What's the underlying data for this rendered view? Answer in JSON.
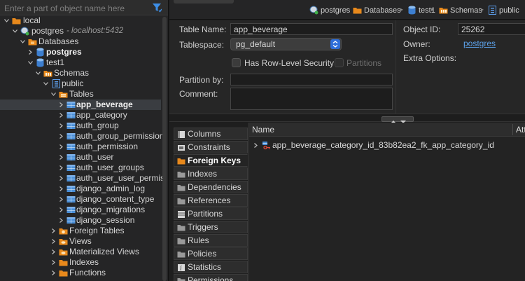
{
  "navigator": {
    "filter_placeholder": "Enter a part of object name here",
    "tree": [
      {
        "label": "local",
        "bold": false
      },
      {
        "label": "postgres",
        "host": "- localhost:5432",
        "bold": false
      },
      {
        "label": "Databases",
        "bold": false
      },
      {
        "label": "postgres",
        "bold": true
      },
      {
        "label": "test1",
        "bold": false
      },
      {
        "label": "Schemas",
        "bold": false
      },
      {
        "label": "public",
        "bold": false
      },
      {
        "label": "Tables",
        "bold": false
      },
      {
        "label": "app_beverage",
        "bold": true,
        "selected": true
      },
      {
        "label": "app_category",
        "bold": false
      },
      {
        "label": "auth_group",
        "bold": false
      },
      {
        "label": "auth_group_permission",
        "bold": false
      },
      {
        "label": "auth_permission",
        "bold": false
      },
      {
        "label": "auth_user",
        "bold": false
      },
      {
        "label": "auth_user_groups",
        "bold": false
      },
      {
        "label": "auth_user_user_permis",
        "bold": false
      },
      {
        "label": "django_admin_log",
        "bold": false
      },
      {
        "label": "django_content_type",
        "bold": false
      },
      {
        "label": "django_migrations",
        "bold": false
      },
      {
        "label": "django_session",
        "bold": false
      },
      {
        "label": "Foreign Tables",
        "bold": false
      },
      {
        "label": "Views",
        "bold": false
      },
      {
        "label": "Materialized Views",
        "bold": false
      },
      {
        "label": "Indexes",
        "bold": false
      },
      {
        "label": "Functions",
        "bold": false
      }
    ]
  },
  "breadcrumb": [
    "postgres",
    "Databases",
    "test1",
    "Schemas",
    "public"
  ],
  "properties": {
    "table_name_label": "Table Name:",
    "table_name_value": "app_beverage",
    "tablespace_label": "Tablespace:",
    "tablespace_value": "pg_default",
    "rls_label": "Has Row-Level Security",
    "partitions_label": "Partitions",
    "partition_by_label": "Partition by:",
    "partition_by_value": "",
    "comment_label": "Comment:",
    "comment_value": "",
    "object_id_label": "Object ID:",
    "object_id_value": "25262",
    "owner_label": "Owner:",
    "owner_value": "postgres",
    "extra_options_label": "Extra Options:"
  },
  "tabs": [
    "Columns",
    "Constraints",
    "Foreign Keys",
    "Indexes",
    "Dependencies",
    "References",
    "Partitions",
    "Triggers",
    "Rules",
    "Policies",
    "Statistics",
    "Permissions"
  ],
  "active_tab": "Foreign Keys",
  "grid": {
    "columns": [
      "Name",
      "Attr"
    ],
    "rows": [
      "app_beverage_category_id_83b82ea2_fk_app_category_id"
    ]
  },
  "colors": {
    "accent_blue": "#2f6ed8",
    "link": "#5ba0e8",
    "folder_orange": "#e8891c",
    "table_blue": "#4a8fd8"
  }
}
